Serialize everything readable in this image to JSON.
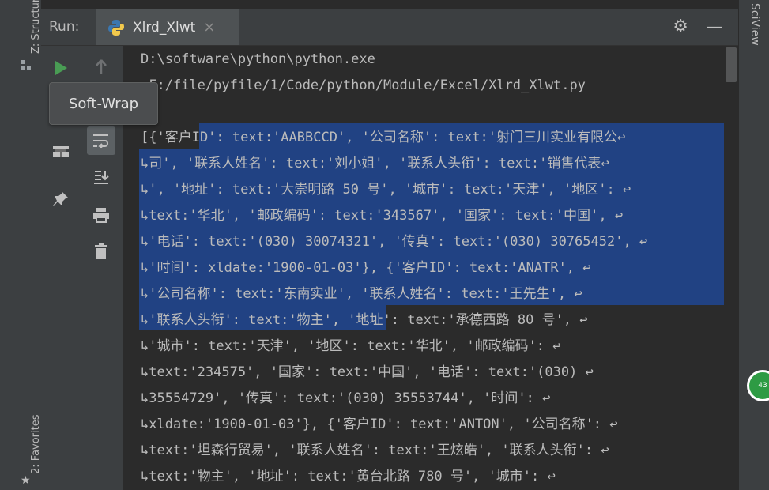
{
  "left_vertical_tabs": {
    "structure": "Z: Structure",
    "favorites": "2: Favorites"
  },
  "right_vertical_tab": "SciView",
  "run": {
    "label": "Run:",
    "tab_label": "Xlrd_Xlwt",
    "close_glyph": "×"
  },
  "tooltip": "Soft-Wrap",
  "green_badge": "43",
  "console_lines": [
    "D:\\software\\python\\python.exe",
    " F:/file/pyfile/1/Code/python/Module/Excel/Xlrd_Xlwt.py",
    "",
    "[{'客户ID': text:'AABBCCD', '公司名称': text:'射门三川实业有限公↩",
    "↳司', '联系人姓名': text:'刘小姐', '联系人头衔': text:'销售代表↩",
    "↳', '地址': text:'大崇明路 50 号', '城市': text:'天津', '地区': ↩",
    "↳text:'华北', '邮政编码': text:'343567', '国家': text:'中国', ↩",
    "↳'电话': text:'(030) 30074321', '传真': text:'(030) 30765452', ↩",
    "↳'时间': xldate:'1900-01-03'}, {'客户ID': text:'ANATR', ↩",
    "↳'公司名称': text:'东南实业', '联系人姓名': text:'王先生', ↩",
    "↳'联系人头衔': text:'物主', '地址': text:'承德西路 80 号', ↩",
    "↳'城市': text:'天津', '地区': text:'华北', '邮政编码': ↩",
    "↳text:'234575', '国家': text:'中国', '电话': text:'(030) ↩",
    "↳35554729', '传真': text:'(030) 35553744', '时间': ↩",
    "↳xldate:'1900-01-03'}, {'客户ID': text:'ANTON', '公司名称': ↩",
    "↳text:'坦森行贸易', '联系人姓名': text:'王炫皓', '联系人头衔': ↩",
    "↳text:'物主', '地址': text:'黄台北路 780 号', '城市': ↩"
  ],
  "colors": {
    "selection": "#214283",
    "panel": "#3c3f41",
    "console_bg": "#2b2b2b",
    "run_green": "#499c54"
  }
}
